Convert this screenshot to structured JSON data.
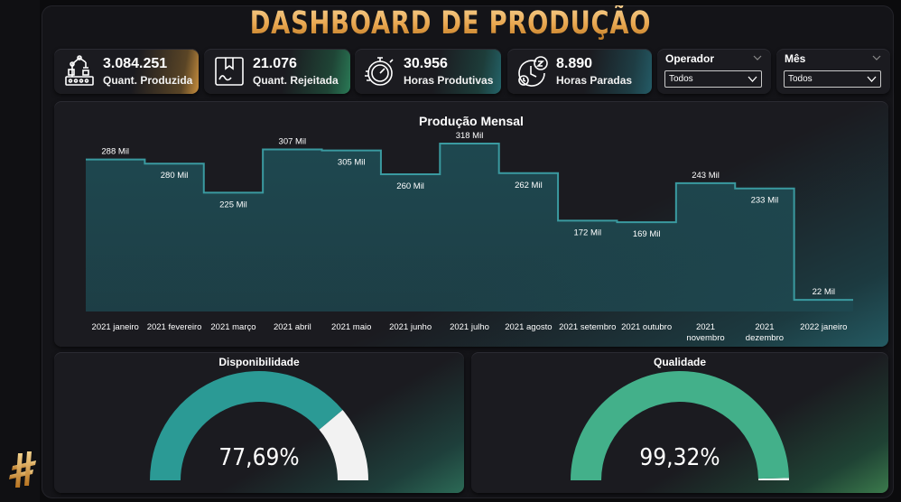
{
  "header": {
    "title": "DASHBOARD DE PRODUÇÃO"
  },
  "kpis": [
    {
      "value": "3.084.251",
      "label": "Quant. Produzida",
      "icon": "factory-robot-icon"
    },
    {
      "value": "21.076",
      "label": "Quant. Rejeitada",
      "icon": "rejected-box-icon"
    },
    {
      "value": "30.956",
      "label": "Horas Produtivas",
      "icon": "stopwatch-icon"
    },
    {
      "value": "8.890",
      "label": "Horas Paradas",
      "icon": "clock-sleep-icon"
    }
  ],
  "slicers": [
    {
      "title": "Operador",
      "value": "Todos"
    },
    {
      "title": "Mês",
      "value": "Todos"
    }
  ],
  "chart_data": {
    "type": "area",
    "title": "Produção Mensal",
    "categories": [
      "2021 janeiro",
      "2021 fevereiro",
      "2021 março",
      "2021 abril",
      "2021 maio",
      "2021 junho",
      "2021 julho",
      "2021 agosto",
      "2021 setembro",
      "2021 outubro",
      "2021 novembro",
      "2021 dezembro",
      "2022 janeiro"
    ],
    "values": [
      288,
      280,
      225,
      307,
      305,
      260,
      318,
      262,
      172,
      169,
      243,
      233,
      22
    ],
    "data_labels": [
      "288 Mil",
      "280 Mil",
      "225 Mil",
      "307 Mil",
      "305 Mil",
      "260 Mil",
      "318 Mil",
      "262 Mil",
      "172 Mil",
      "169 Mil",
      "243 Mil",
      "233 Mil",
      "22 Mil"
    ],
    "value_unit": "Mil",
    "ylim": [
      0,
      330
    ],
    "step": true,
    "grid": false,
    "line_color": "#3a9aa0",
    "fill_color": "#1e4a52"
  },
  "gauges": [
    {
      "title": "Disponibilidade",
      "value": 77.69,
      "label": "77,69%",
      "fill_color": "#2b9a95",
      "rest_color": "#f2f2f2"
    },
    {
      "title": "Qualidade",
      "value": 99.32,
      "label": "99,32%",
      "fill_color": "#43b08a",
      "rest_color": "#f2f2f2"
    }
  ],
  "colors": {
    "title_gold": "#e7a44c",
    "background": "#141418",
    "card": "#1b1b20"
  }
}
